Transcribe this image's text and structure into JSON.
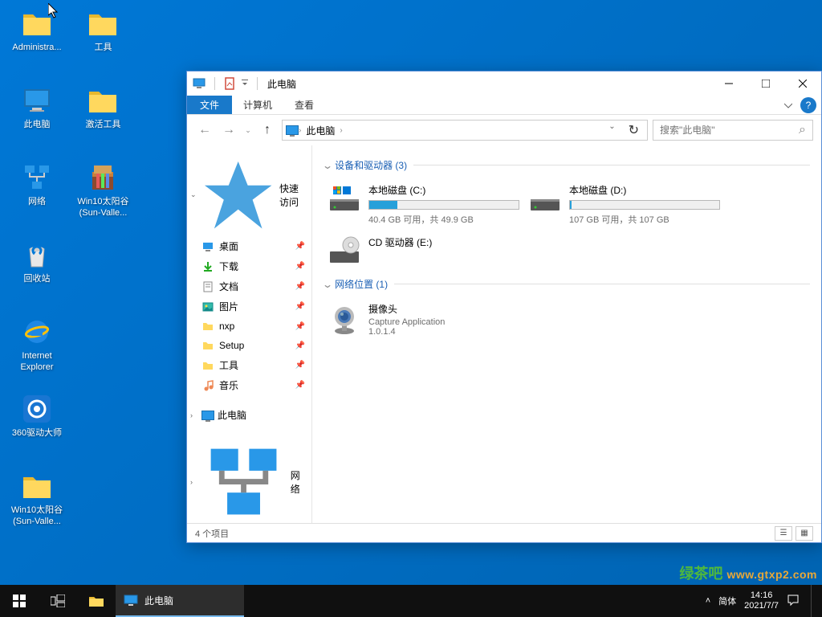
{
  "desktop": {
    "icons_col1": [
      {
        "label": "Administra...",
        "type": "folder"
      },
      {
        "label": "此电脑",
        "type": "pc"
      },
      {
        "label": "网络",
        "type": "network"
      },
      {
        "label": "回收站",
        "type": "recycle"
      },
      {
        "label": "Internet Explorer",
        "type": "ie"
      },
      {
        "label": "360驱动大师",
        "type": "app360"
      },
      {
        "label": "Win10太阳谷 (Sun-Valle...",
        "type": "folder"
      }
    ],
    "icons_col2": [
      {
        "label": "工具",
        "type": "folder"
      },
      {
        "label": "激活工具",
        "type": "folder"
      },
      {
        "label": "Win10太阳谷 (Sun-Valle...",
        "type": "winrar"
      }
    ]
  },
  "explorer": {
    "title": "此电脑",
    "ribbon": {
      "file": "文件",
      "tabs": [
        "计算机",
        "查看"
      ]
    },
    "breadcrumb": "此电脑",
    "search_placeholder": "搜索\"此电脑\"",
    "nav": {
      "quick": "快速访问",
      "items": [
        "桌面",
        "下载",
        "文档",
        "图片",
        "nxp",
        "Setup",
        "工具",
        "音乐"
      ],
      "pc": "此电脑",
      "network": "网络"
    },
    "groups": {
      "devices": {
        "title": "设备和驱动器 (3)"
      },
      "network": {
        "title": "网络位置 (1)"
      }
    },
    "drives": [
      {
        "name": "本地磁盘 (C:)",
        "text": "40.4 GB 可用，共 49.9 GB",
        "fill": 19
      },
      {
        "name": "本地磁盘 (D:)",
        "text": "107 GB 可用，共 107 GB",
        "fill": 1
      }
    ],
    "cdrom": {
      "name": "CD 驱动器 (E:)"
    },
    "netloc": {
      "name": "摄像头",
      "line2": "Capture Application",
      "line3": "1.0.1.4"
    },
    "status": "4 个项目"
  },
  "taskbar": {
    "app": "此电脑",
    "time": "14:16",
    "date": "2021/7/7",
    "lang": "简体"
  },
  "watermark": {
    "a": "绿茶吧",
    "b": "www.gtxp2.com"
  }
}
